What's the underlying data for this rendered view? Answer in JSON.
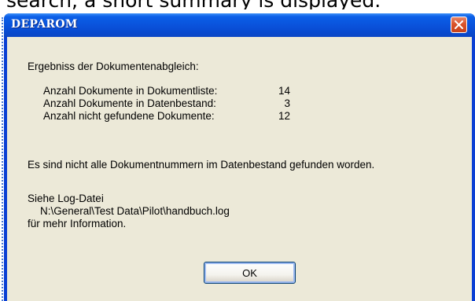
{
  "document": {
    "fragment_text": "search, a short summary is displayed."
  },
  "dialog": {
    "title": "DEPAROM",
    "close_icon": "close-icon",
    "heading": "Ergebniss der Dokumentenabgleich:",
    "stats": [
      {
        "label": "Anzahl Dokumente in Dokumentliste:",
        "value": "14"
      },
      {
        "label": "Anzahl Dokumente in Datenbestand:",
        "value": "3"
      },
      {
        "label": "Anzahl nicht gefundene Dokumente:",
        "value": "12"
      }
    ],
    "warning": "Es sind nicht alle Dokumentnummern im Datenbestand gefunden worden.",
    "log_label": "Siehe Log-Datei",
    "log_path": "N:\\General\\Test Data\\Pilot\\handbuch.log",
    "log_info": "für mehr Information.",
    "ok_label": "OK"
  },
  "colors": {
    "titlebar": "#0a53dc",
    "client_background": "#ece9d8",
    "close_button": "#d9542b"
  }
}
